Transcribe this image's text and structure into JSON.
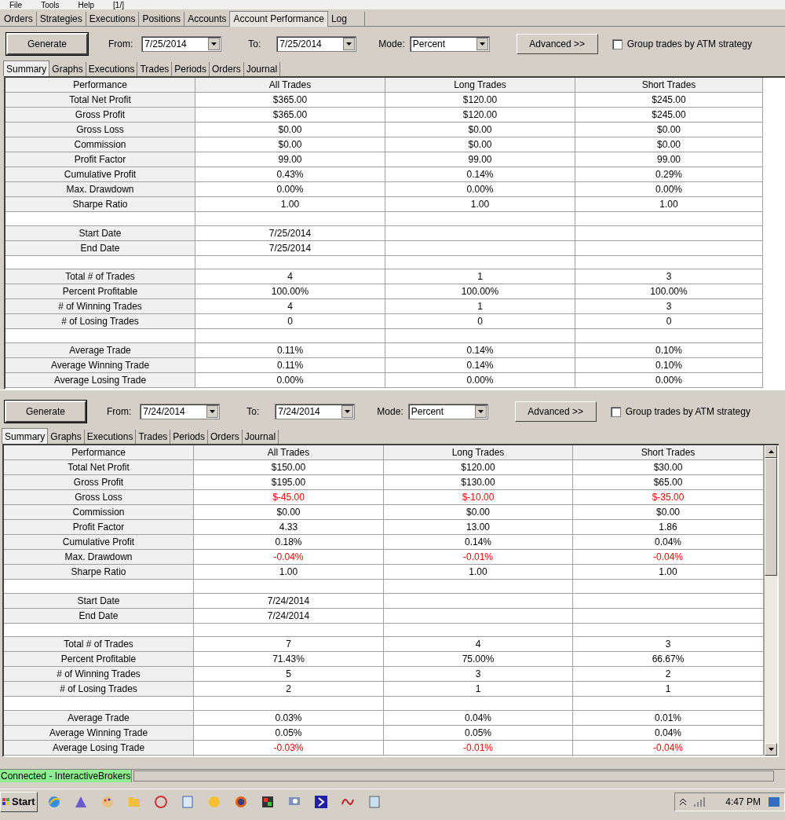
{
  "menu": [
    "File",
    "Tools",
    "Help",
    "[1/]"
  ],
  "main_tabs": [
    {
      "label": "Orders",
      "selected": false
    },
    {
      "label": "Strategies",
      "selected": false
    },
    {
      "label": "Executions",
      "selected": false
    },
    {
      "label": "Positions",
      "selected": false
    },
    {
      "label": "Accounts",
      "selected": false
    },
    {
      "label": "Account Performance",
      "selected": true
    },
    {
      "label": "Log",
      "selected": false
    }
  ],
  "reports": [
    {
      "generate": "Generate",
      "from_label": "From:",
      "from": "7/25/2014",
      "to_label": "To:",
      "to": "7/25/2014",
      "mode_label": "Mode:",
      "mode": "Percent",
      "advanced": "Advanced >>",
      "group_trades": {
        "label": "Group trades by ATM strategy",
        "checked": false
      },
      "sub_tabs": [
        {
          "label": "Summary",
          "selected": true
        },
        {
          "label": "Graphs",
          "selected": false
        },
        {
          "label": "Executions",
          "selected": false
        },
        {
          "label": "Trades",
          "selected": false
        },
        {
          "label": "Periods",
          "selected": false
        },
        {
          "label": "Orders",
          "selected": false
        },
        {
          "label": "Journal",
          "selected": false
        }
      ],
      "columns": [
        "Performance",
        "All Trades",
        "Long Trades",
        "Short Trades"
      ],
      "rows": [
        {
          "kind": "data",
          "label": "Total Net Profit",
          "values": [
            "$365.00",
            "$120.00",
            "$245.00"
          ],
          "negative": false
        },
        {
          "kind": "data",
          "label": "Gross Profit",
          "values": [
            "$365.00",
            "$120.00",
            "$245.00"
          ],
          "negative": false
        },
        {
          "kind": "data",
          "label": "Gross Loss",
          "values": [
            "$0.00",
            "$0.00",
            "$0.00"
          ],
          "negative": false
        },
        {
          "kind": "data",
          "label": "Commission",
          "values": [
            "$0.00",
            "$0.00",
            "$0.00"
          ],
          "negative": false
        },
        {
          "kind": "data",
          "label": "Profit Factor",
          "values": [
            "99.00",
            "99.00",
            "99.00"
          ],
          "negative": false
        },
        {
          "kind": "data",
          "label": "Cumulative Profit",
          "values": [
            "0.43%",
            "0.14%",
            "0.29%"
          ],
          "negative": false
        },
        {
          "kind": "data",
          "label": "Max. Drawdown",
          "values": [
            "0.00%",
            "0.00%",
            "0.00%"
          ],
          "negative": false
        },
        {
          "kind": "data",
          "label": "Sharpe Ratio",
          "values": [
            "1.00",
            "1.00",
            "1.00"
          ],
          "negative": false
        },
        {
          "kind": "spacer"
        },
        {
          "kind": "data",
          "label": "Start Date",
          "values": [
            "7/25/2014"
          ],
          "negative": false
        },
        {
          "kind": "data",
          "label": "End Date",
          "values": [
            "7/25/2014"
          ],
          "negative": false
        },
        {
          "kind": "spacer"
        },
        {
          "kind": "data",
          "label": "Total # of Trades",
          "values": [
            "4",
            "1",
            "3"
          ],
          "negative": false
        },
        {
          "kind": "data",
          "label": "Percent Profitable",
          "values": [
            "100.00%",
            "100.00%",
            "100.00%"
          ],
          "negative": false
        },
        {
          "kind": "data",
          "label": "# of Winning Trades",
          "values": [
            "4",
            "1",
            "3"
          ],
          "negative": false
        },
        {
          "kind": "data",
          "label": "# of Losing Trades",
          "values": [
            "0",
            "0",
            "0"
          ],
          "negative": false
        },
        {
          "kind": "spacer"
        },
        {
          "kind": "data",
          "label": "Average Trade",
          "values": [
            "0.11%",
            "0.14%",
            "0.10%"
          ],
          "negative": false
        },
        {
          "kind": "data",
          "label": "Average Winning Trade",
          "values": [
            "0.11%",
            "0.14%",
            "0.10%"
          ],
          "negative": false
        },
        {
          "kind": "data",
          "label": "Average Losing Trade",
          "values": [
            "0.00%",
            "0.00%",
            "0.00%"
          ],
          "negative": false
        }
      ]
    },
    {
      "generate": "Generate",
      "from_label": "From:",
      "from": "7/24/2014",
      "to_label": "To:",
      "to": "7/24/2014",
      "mode_label": "Mode:",
      "mode": "Percent",
      "advanced": "Advanced >>",
      "group_trades": {
        "label": "Group trades by ATM strategy",
        "checked": false
      },
      "sub_tabs": [
        {
          "label": "Summary",
          "selected": true
        },
        {
          "label": "Graphs",
          "selected": false
        },
        {
          "label": "Executions",
          "selected": false
        },
        {
          "label": "Trades",
          "selected": false
        },
        {
          "label": "Periods",
          "selected": false
        },
        {
          "label": "Orders",
          "selected": false
        },
        {
          "label": "Journal",
          "selected": false
        }
      ],
      "columns": [
        "Performance",
        "All Trades",
        "Long Trades",
        "Short Trades"
      ],
      "rows": [
        {
          "kind": "data",
          "label": "Total Net Profit",
          "values": [
            "$150.00",
            "$120.00",
            "$30.00"
          ],
          "negative": false
        },
        {
          "kind": "data",
          "label": "Gross Profit",
          "values": [
            "$195.00",
            "$130.00",
            "$65.00"
          ],
          "negative": false
        },
        {
          "kind": "data",
          "label": "Gross Loss",
          "values": [
            "$-45.00",
            "$-10.00",
            "$-35.00"
          ],
          "negative": true
        },
        {
          "kind": "data",
          "label": "Commission",
          "values": [
            "$0.00",
            "$0.00",
            "$0.00"
          ],
          "negative": false
        },
        {
          "kind": "data",
          "label": "Profit Factor",
          "values": [
            "4.33",
            "13.00",
            "1.86"
          ],
          "negative": false
        },
        {
          "kind": "data",
          "label": "Cumulative Profit",
          "values": [
            "0.18%",
            "0.14%",
            "0.04%"
          ],
          "negative": false
        },
        {
          "kind": "data",
          "label": "Max. Drawdown",
          "values": [
            "-0.04%",
            "-0.01%",
            "-0.04%"
          ],
          "negative": true
        },
        {
          "kind": "data",
          "label": "Sharpe Ratio",
          "values": [
            "1.00",
            "1.00",
            "1.00"
          ],
          "negative": false
        },
        {
          "kind": "spacer"
        },
        {
          "kind": "data",
          "label": "Start Date",
          "values": [
            "7/24/2014"
          ],
          "negative": false
        },
        {
          "kind": "data",
          "label": "End Date",
          "values": [
            "7/24/2014"
          ],
          "negative": false
        },
        {
          "kind": "spacer"
        },
        {
          "kind": "data",
          "label": "Total # of Trades",
          "values": [
            "7",
            "4",
            "3"
          ],
          "negative": false
        },
        {
          "kind": "data",
          "label": "Percent Profitable",
          "values": [
            "71.43%",
            "75.00%",
            "66.67%"
          ],
          "negative": false
        },
        {
          "kind": "data",
          "label": "# of Winning Trades",
          "values": [
            "5",
            "3",
            "2"
          ],
          "negative": false
        },
        {
          "kind": "data",
          "label": "# of Losing Trades",
          "values": [
            "2",
            "1",
            "1"
          ],
          "negative": false
        },
        {
          "kind": "spacer"
        },
        {
          "kind": "data",
          "label": "Average Trade",
          "values": [
            "0.03%",
            "0.04%",
            "0.01%"
          ],
          "negative": false
        },
        {
          "kind": "data",
          "label": "Average Winning Trade",
          "values": [
            "0.05%",
            "0.05%",
            "0.04%"
          ],
          "negative": false
        },
        {
          "kind": "data",
          "label": "Average Losing Trade",
          "values": [
            "-0.03%",
            "-0.01%",
            "-0.04%"
          ],
          "negative": true
        }
      ]
    }
  ],
  "status_bar": "Connected - InteractiveBrokers",
  "taskbar": {
    "start": "Start",
    "time": "4:47 PM"
  }
}
